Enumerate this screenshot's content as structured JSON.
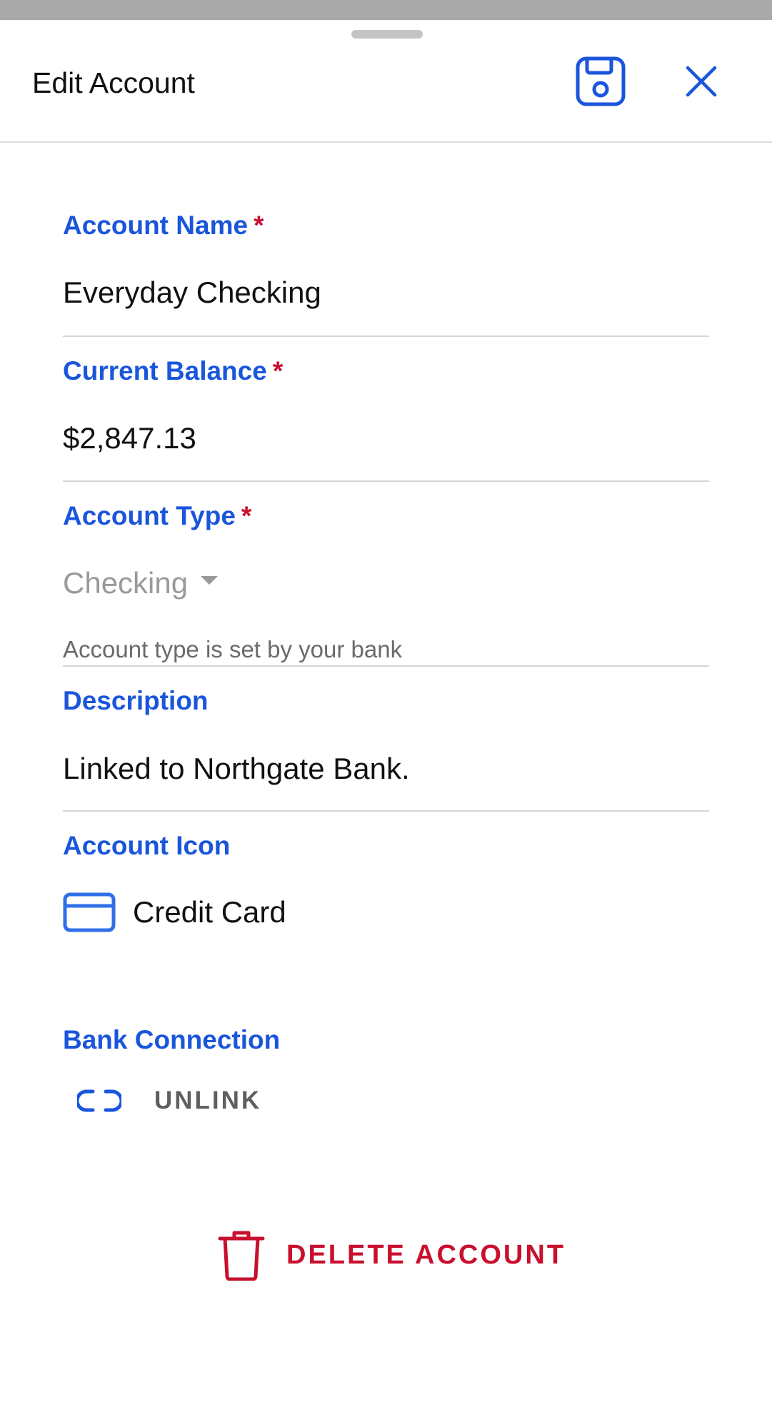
{
  "header": {
    "title": "Edit Account",
    "save_icon": "save-icon",
    "close_icon": "close-icon"
  },
  "fields": {
    "account_name": {
      "label": "Account Name",
      "required_mark": "*",
      "value": "Everyday Checking"
    },
    "current_balance": {
      "label": "Current Balance",
      "required_mark": "*",
      "value": "$2,847.13"
    },
    "account_type": {
      "label": "Account Type",
      "required_mark": "*",
      "value": "Checking",
      "helper": "Account type is set by your bank"
    },
    "description": {
      "label": "Description",
      "value": "Linked to Northgate Bank."
    },
    "account_icon": {
      "label": "Account Icon",
      "icon": "credit-card-icon",
      "value": "Credit Card"
    },
    "bank_connection": {
      "label": "Bank Connection",
      "icon": "unlink-icon",
      "action_label": "UNLINK"
    }
  },
  "delete": {
    "icon": "trash-icon",
    "label": "DELETE ACCOUNT"
  },
  "colors": {
    "accent": "#1a56db",
    "required": "#c8102e",
    "danger": "#c8102e",
    "muted": "#9a9a9a"
  }
}
